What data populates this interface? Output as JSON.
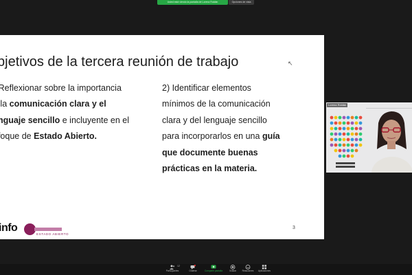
{
  "meeting": {
    "banner_text": "Usted está viendo la pantalla de Lorena Roldán",
    "view_options": "Opciones de vista"
  },
  "slide": {
    "title": "bjetivos de la tercera reunión de trabajo",
    "left_column": {
      "p1": ") Reflexionar sobre la importancia",
      "p2a": "e la ",
      "p2b": "comunicación clara y el",
      "p3a": "enguaje sencillo",
      "p3b": " e incluyente en el",
      "p4a": "nfoque de ",
      "p4b": "Estado Abierto."
    },
    "right_column": {
      "l1": "2) Identificar elementos",
      "l2": "mínimos de la comunicación",
      "l3": "clara y del lenguaje sencillo",
      "l4a": "para incorporarlos en una ",
      "l4b": "guía",
      "l5": "que documente buenas",
      "l6": "prácticas en la materia."
    },
    "page_number": "3",
    "logo_info": "info",
    "logo_ea": "ESTADO ABIERTO"
  },
  "participant_tile": {
    "name": "Lorena Roldán"
  },
  "toolbar": {
    "items": [
      {
        "label": "Participantes",
        "count": "12"
      },
      {
        "label": "Chatear"
      },
      {
        "label": "Compartir pantalla"
      },
      {
        "label": "Grabar"
      },
      {
        "label": "Reacciones"
      },
      {
        "label": "Aplicaciones"
      }
    ]
  },
  "colors": {
    "share_green": "#27a745",
    "brand_purple": "#8a1f5b",
    "chat_badge": "#e02f2f"
  }
}
